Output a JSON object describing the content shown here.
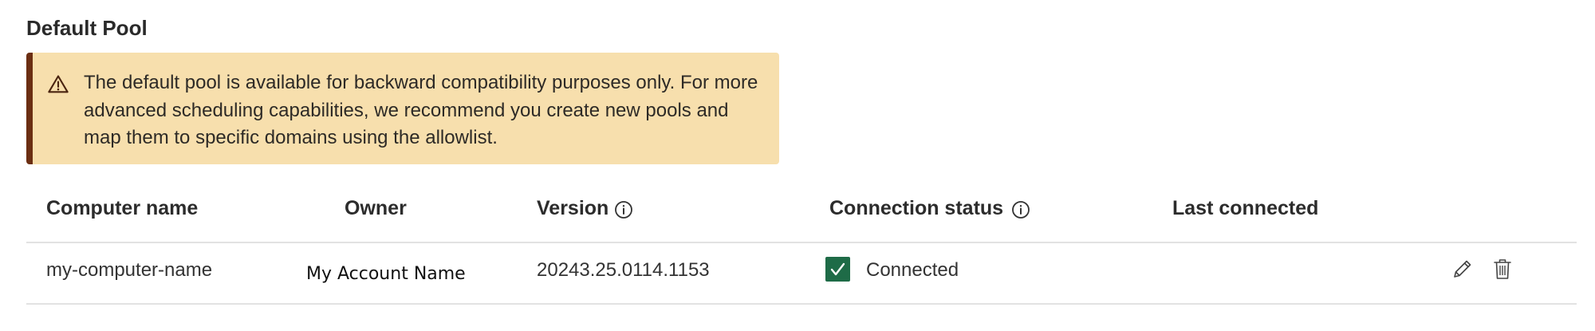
{
  "section": {
    "title": "Default Pool"
  },
  "banner": {
    "icon": "warning-triangle-icon",
    "message": "The default pool is available for backward compatibility purposes only. For more advanced scheduling capabilities, we recommend you create new pools and map them to specific domains using the allowlist.",
    "background": "#f7dfad",
    "accent": "#6b2e12"
  },
  "table": {
    "columns": {
      "computer_name": "Computer name",
      "owner": "Owner",
      "version": "Version",
      "connection_status": "Connection status",
      "last_connected": "Last connected"
    },
    "rows": [
      {
        "computer_name": "my-computer-name",
        "owner": "My Account Name",
        "version": "20243.25.0114.1153",
        "connection_status": "Connected",
        "last_connected": ""
      }
    ]
  },
  "colors": {
    "connected": "#1e6b47"
  }
}
